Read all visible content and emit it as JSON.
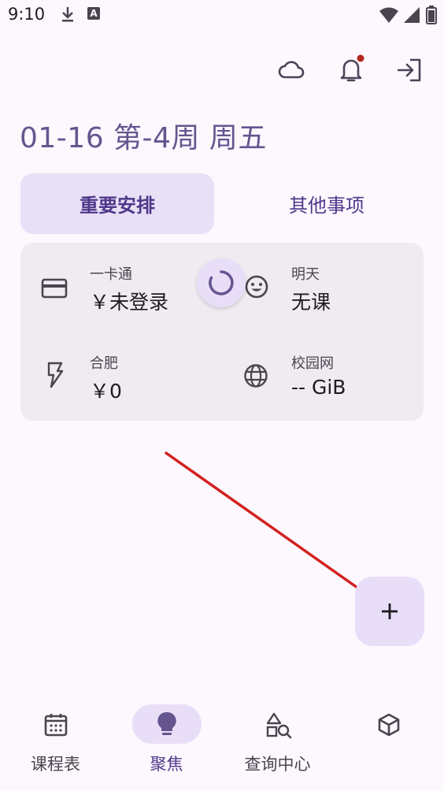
{
  "status_bar": {
    "time": "9:10",
    "a_badge": "A"
  },
  "header": {
    "date_title": "01-16 第-4周 周五",
    "icons": [
      "cloud-icon",
      "notification-bell-icon",
      "login-icon"
    ]
  },
  "tabs": [
    {
      "label": "重要安排",
      "active": true
    },
    {
      "label": "其他事项",
      "active": false
    }
  ],
  "info_card": {
    "card": {
      "label": "一卡通",
      "value": "￥未登录"
    },
    "tomorrow": {
      "label": "明天",
      "value": "无课"
    },
    "electricity": {
      "label": "合肥",
      "value": "￥0"
    },
    "network": {
      "label": "校园网",
      "value": "-- GiB"
    }
  },
  "fab": {
    "label": "+"
  },
  "bottom_nav": [
    {
      "label": "课程表",
      "icon": "calendar-icon",
      "active": false
    },
    {
      "label": "聚焦",
      "icon": "lightbulb-icon",
      "active": true
    },
    {
      "label": "查询中心",
      "icon": "shapes-search-icon",
      "active": false
    },
    {
      "label": "",
      "icon": "cube-icon",
      "active": false
    }
  ],
  "colors": {
    "background": "#fdf7fe",
    "primary": "#65558f",
    "active_container": "#e8def8",
    "card_background": "#efebf1",
    "annotation_arrow": "#d32020"
  }
}
